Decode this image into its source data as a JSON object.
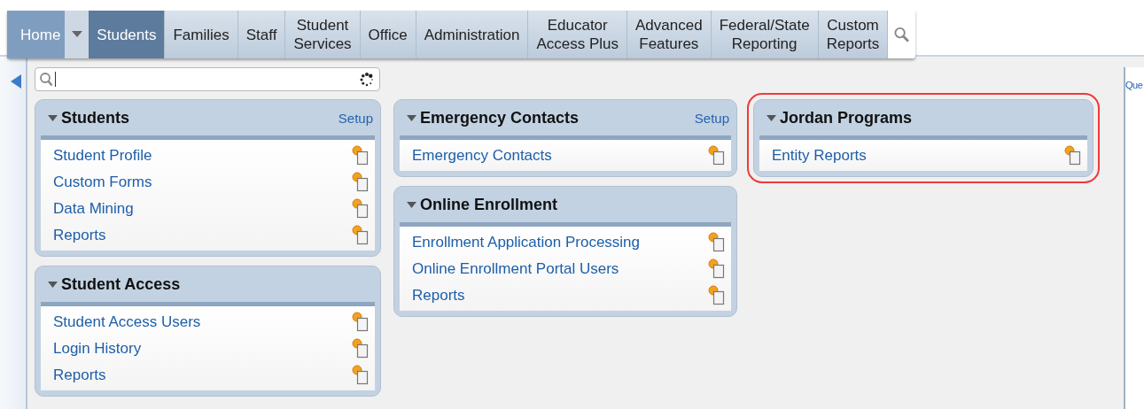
{
  "nav": {
    "home": "Home",
    "tabs": [
      {
        "label": "Students",
        "selected": true
      },
      {
        "label": "Families",
        "selected": false
      },
      {
        "label": "Staff",
        "selected": false
      },
      {
        "label": "Student\nServices",
        "selected": false
      },
      {
        "label": "Office",
        "selected": false
      },
      {
        "label": "Administration",
        "selected": false
      },
      {
        "label": "Educator\nAccess Plus",
        "selected": false
      },
      {
        "label": "Advanced\nFeatures",
        "selected": false
      },
      {
        "label": "Federal/State\nReporting",
        "selected": false
      },
      {
        "label": "Custom\nReports",
        "selected": false
      }
    ]
  },
  "columns": [
    [
      {
        "title": "Students",
        "setup": "Setup",
        "highlighted": false,
        "items": [
          "Student Profile",
          "Custom Forms",
          "Data Mining",
          "Reports"
        ]
      },
      {
        "title": "Student Access",
        "highlighted": false,
        "items": [
          "Student Access Users",
          "Login History",
          "Reports"
        ]
      }
    ],
    [
      {
        "title": "Emergency Contacts",
        "setup": "Setup",
        "highlighted": false,
        "items": [
          "Emergency Contacts"
        ]
      },
      {
        "title": "Online Enrollment",
        "highlighted": false,
        "items": [
          "Enrollment Application Processing",
          "Online Enrollment Portal Users",
          "Reports"
        ]
      }
    ],
    [
      {
        "title": "Jordan Programs",
        "highlighted": true,
        "items": [
          "Entity Reports"
        ]
      }
    ]
  ],
  "background_page": {
    "link": "Que"
  }
}
